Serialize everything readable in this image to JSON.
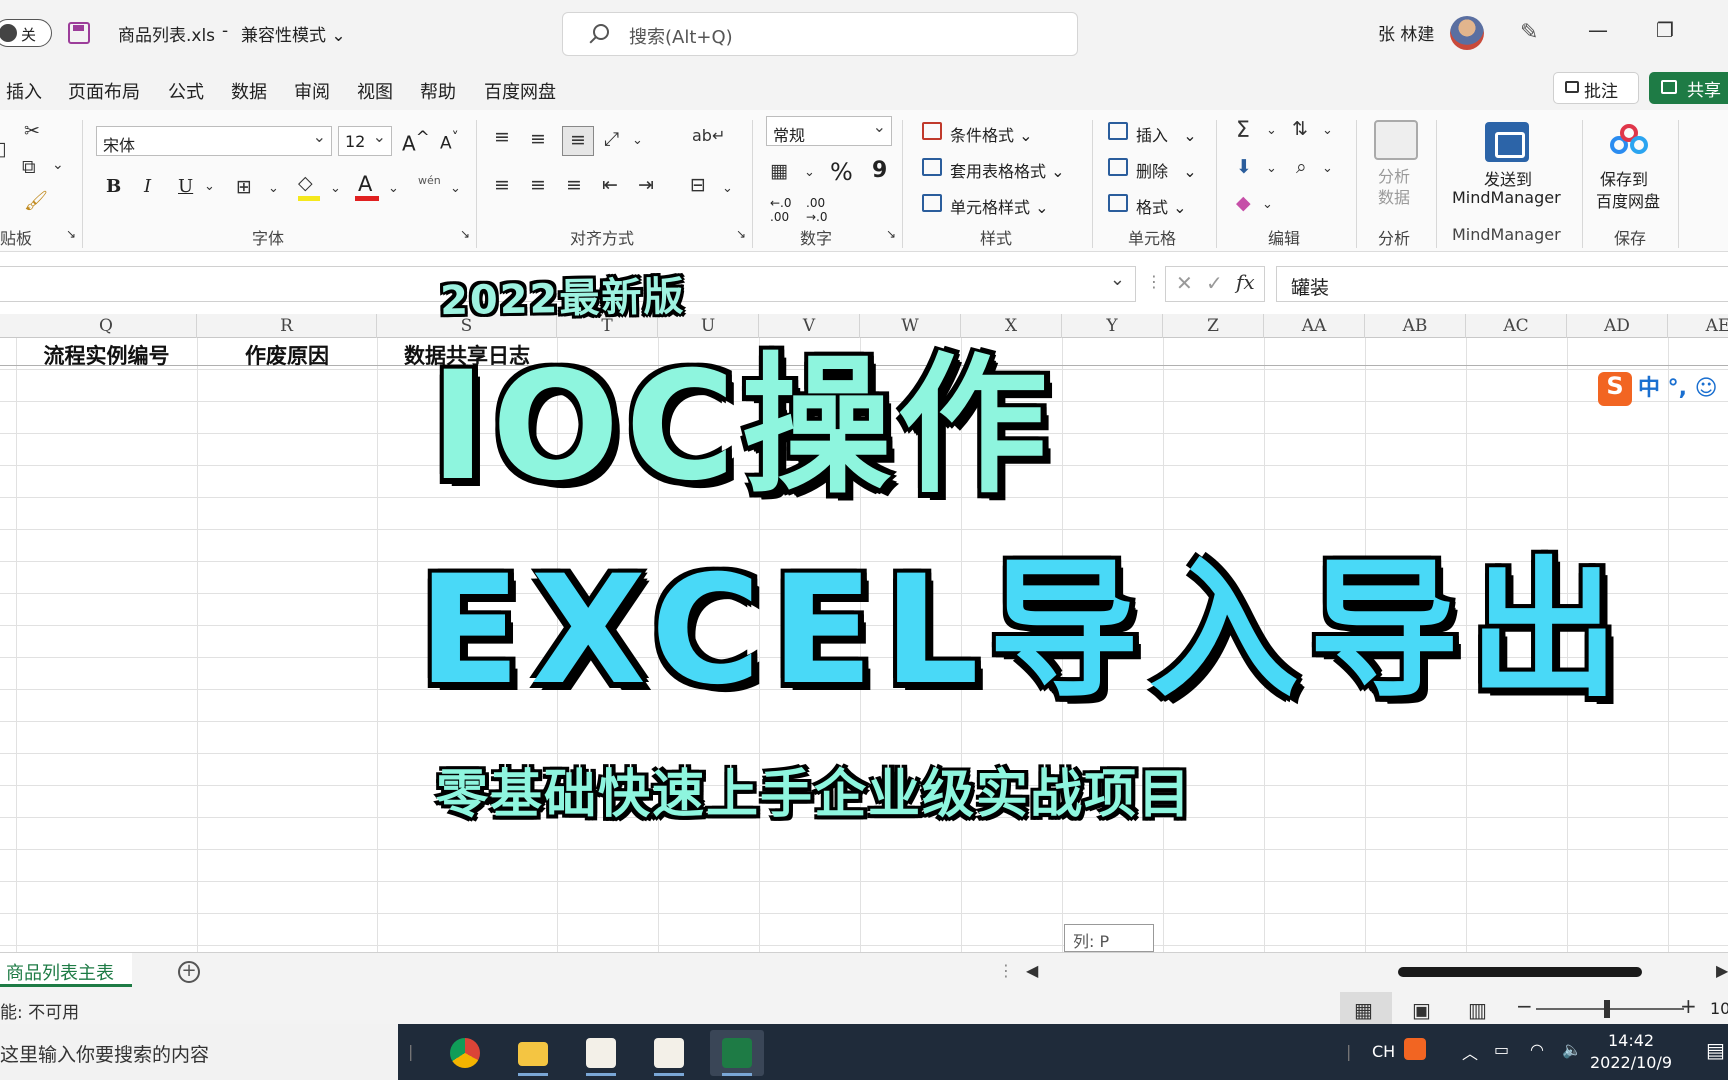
{
  "titlebar": {
    "autosave_label": "关",
    "filename": "商品列表.xls",
    "separator": "-",
    "compat_mode": "兼容性模式",
    "search_placeholder": "搜索(Alt+Q)",
    "user_name": "张 林建"
  },
  "menu": {
    "tabs": [
      "插入",
      "页面布局",
      "公式",
      "数据",
      "审阅",
      "视图",
      "帮助",
      "百度网盘"
    ],
    "comment_label": "批注",
    "share_label": "共享"
  },
  "ribbon": {
    "font_name": "宋体",
    "font_size": "12",
    "number_format": "常规",
    "groups": {
      "clipboard": "贴板",
      "font": "字体",
      "alignment": "对齐方式",
      "number": "数字",
      "styles": "样式",
      "cells": "单元格",
      "editing": "编辑",
      "analysis": "分析",
      "mindmanager": "MindManager",
      "save": "保存"
    },
    "styles_items": [
      "条件格式",
      "套用表格格式",
      "单元格样式"
    ],
    "cells_items": [
      "插入",
      "删除",
      "格式"
    ],
    "analyze_label": "分析\n数据",
    "send_to": "发送到",
    "mindmanager_label": "MindManager",
    "save_to": "保存到",
    "baidu_pan": "百度网盘",
    "wen": "wén",
    "percent": "%",
    "comma": "9"
  },
  "formula_bar": {
    "value": "罐装",
    "fx": "fx"
  },
  "columns": [
    "Q",
    "R",
    "S",
    "T",
    "U",
    "V",
    "W",
    "X",
    "Y",
    "Z",
    "AA",
    "AB",
    "AC",
    "AD",
    "AE"
  ],
  "header_row": [
    "流程实例编号",
    "作废原因",
    "数据共享日志"
  ],
  "promo": {
    "version": "2022最新版",
    "title_line1": "IOC操作",
    "title_line2": "EXCEL导入导出",
    "subtitle": "零基础快速上手企业级实战项目"
  },
  "ime": {
    "logo": "S",
    "label": "中 °, ☺"
  },
  "col_tooltip": "列: P",
  "sheet_tab": "商品列表主表",
  "status": {
    "text": "能: 不可用",
    "zoom_partial": "10"
  },
  "taskbar": {
    "search_placeholder": "这里输入你要搜索的内容",
    "lang": "CH",
    "time": "14:42",
    "date": "2022/10/9"
  }
}
